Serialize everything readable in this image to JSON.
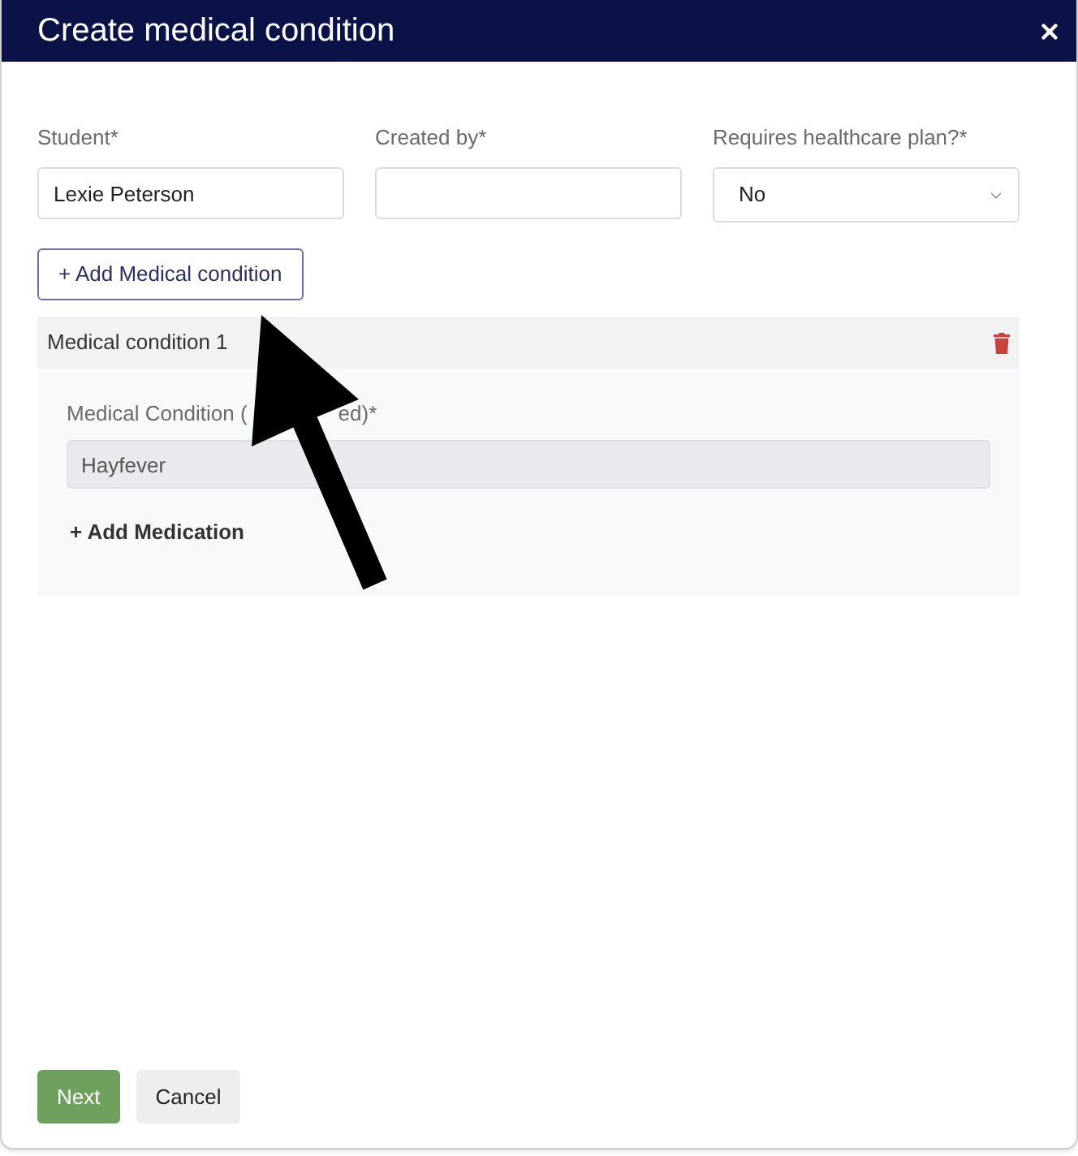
{
  "dialog": {
    "title": "Create medical condition"
  },
  "fields": [
    {
      "label": "Student*",
      "kind": "text",
      "value": "Lexie Peterson"
    },
    {
      "label": "Created by*",
      "kind": "text"
    },
    {
      "label": "Requires healthcare plan?*",
      "kind": "select",
      "value": "No"
    }
  ],
  "add_condition_button": "+ Add Medical condition",
  "conditions": [
    {
      "title": "Medical condition 1",
      "field": {
        "label_parts": [
          "Medical Condition (",
          "ed)*"
        ],
        "value": "Hayfever",
        "disabled": true
      },
      "add_medication": "+ Add Medication"
    }
  ],
  "buttons": [
    {
      "label": "Next",
      "kind": "primary"
    },
    {
      "label": "Cancel",
      "kind": "secondary"
    }
  ]
}
